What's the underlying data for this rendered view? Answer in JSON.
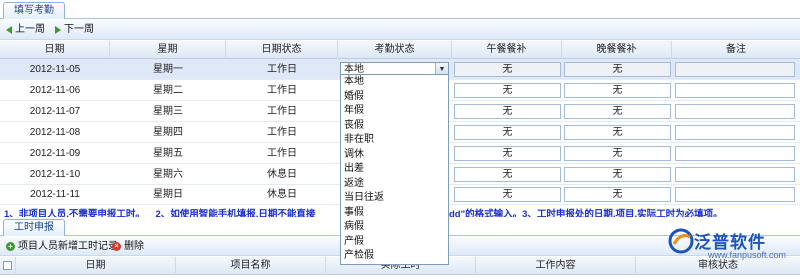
{
  "top_tab": "填写考勤",
  "week_nav": {
    "prev": "上一周",
    "next": "下一周"
  },
  "columns": [
    "日期",
    "星期",
    "日期状态",
    "考勤状态",
    "午餐餐补",
    "晚餐餐补",
    "备注"
  ],
  "rows": [
    {
      "date": "2012-11-05",
      "weekday": "星期一",
      "day_status": "工作日",
      "attendance": "本地",
      "lunch": "无",
      "dinner": "无",
      "note": ""
    },
    {
      "date": "2012-11-06",
      "weekday": "星期二",
      "day_status": "工作日",
      "attendance": "",
      "lunch": "无",
      "dinner": "无",
      "note": ""
    },
    {
      "date": "2012-11-07",
      "weekday": "星期三",
      "day_status": "工作日",
      "attendance": "",
      "lunch": "无",
      "dinner": "无",
      "note": ""
    },
    {
      "date": "2012-11-08",
      "weekday": "星期四",
      "day_status": "工作日",
      "attendance": "",
      "lunch": "无",
      "dinner": "无",
      "note": ""
    },
    {
      "date": "2012-11-09",
      "weekday": "星期五",
      "day_status": "工作日",
      "attendance": "",
      "lunch": "无",
      "dinner": "无",
      "note": ""
    },
    {
      "date": "2012-11-10",
      "weekday": "星期六",
      "day_status": "休息日",
      "attendance": "",
      "lunch": "无",
      "dinner": "无",
      "note": ""
    },
    {
      "date": "2012-11-11",
      "weekday": "星期日",
      "day_status": "休息日",
      "attendance": "",
      "lunch": "无",
      "dinner": "无",
      "note": ""
    }
  ],
  "attendance_options": [
    "本地",
    "婚假",
    "年假",
    "丧假",
    "非在职",
    "调休",
    "出差",
    "返途",
    "当日往返",
    "事假",
    "病假",
    "产假",
    "产检假"
  ],
  "notice_left": "1、非项目人员,不需要申报工时。    2、如使用智能手机填报,日期不能直接",
  "notice_right": "dd\"的格式输入。3、工时申报处的日期,项目,实际工时为必填项。",
  "bottom_tab": "工时申报",
  "bottom_toolbar": {
    "add": "项目人员新增工时记录",
    "delete": "删除"
  },
  "bottom_columns": [
    "日期",
    "项目名称",
    "实际工时",
    "工作内容",
    "审核状态"
  ],
  "logo": {
    "text": "泛普软件",
    "url": "www.fanpusoft.com"
  },
  "colors": {
    "accent": "#15428b",
    "notice": "#1b2fd0",
    "brand": "#1c54b8"
  }
}
